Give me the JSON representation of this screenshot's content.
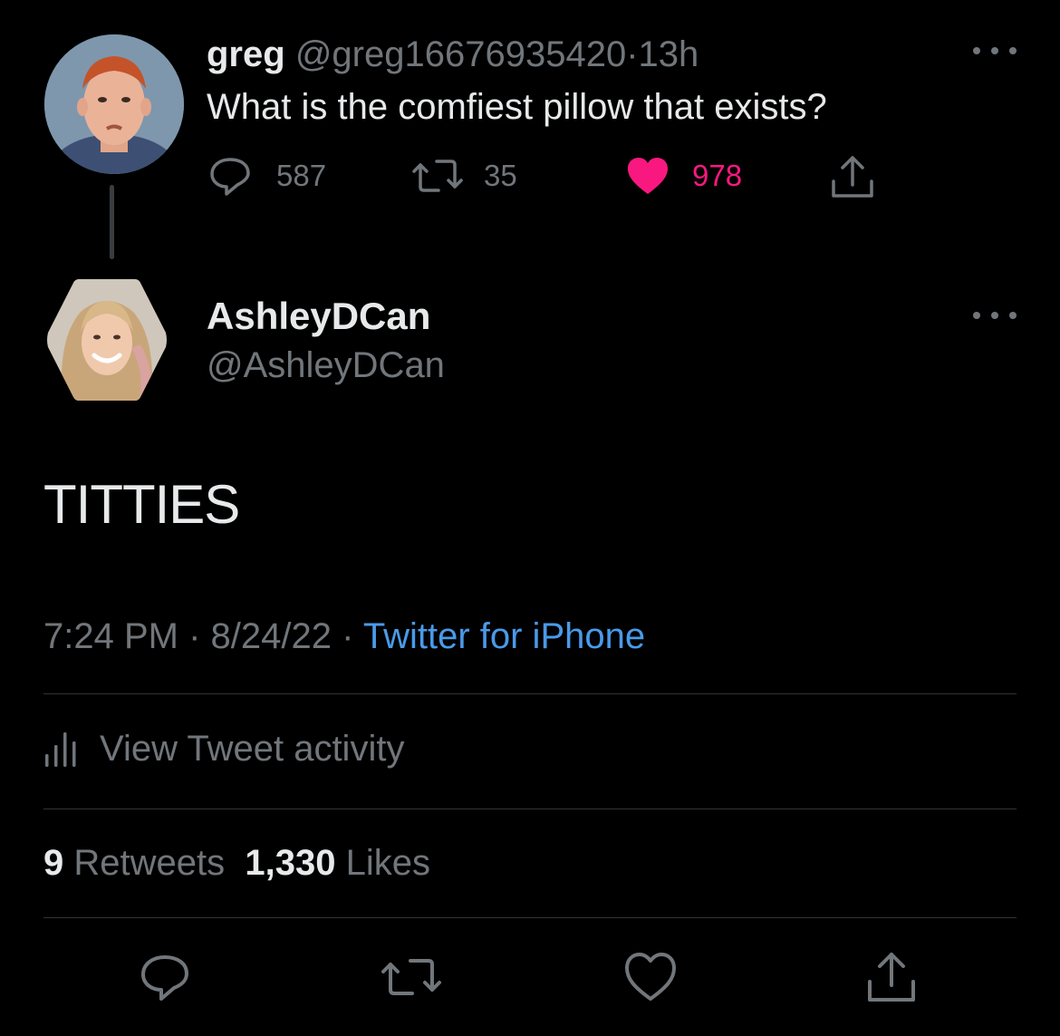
{
  "parent_tweet": {
    "display_name": "greg",
    "handle": "@greg16676935420",
    "separator": "·",
    "time_ago": "13h",
    "text": "What is the comfiest pillow that exists?",
    "replies": "587",
    "retweets": "35",
    "likes": "978",
    "liked": true,
    "like_color": "#f91880"
  },
  "reply_tweet": {
    "display_name": "AshleyDCan",
    "handle": "@AshleyDCan",
    "text": "TITTIES",
    "time": "7:24 PM",
    "separator": "·",
    "date": "8/24/22",
    "source": "Twitter for iPhone",
    "source_color": "#4a9ae9",
    "activity_label": "View Tweet activity",
    "retweet_count": "9",
    "retweet_label": "Retweets",
    "like_count": "1,330",
    "like_label": "Likes"
  },
  "icons": {
    "reply": "reply-icon",
    "retweet": "retweet-icon",
    "like": "heart-icon",
    "share": "share-icon",
    "more": "more-icon",
    "activity": "bar-chart-icon"
  }
}
